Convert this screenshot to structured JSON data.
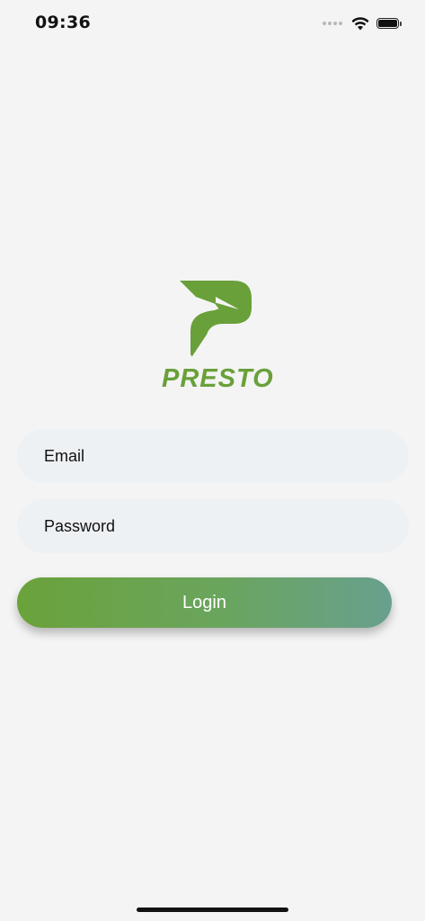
{
  "status_bar": {
    "time": "09:36"
  },
  "logo": {
    "text": "PRESTO",
    "icon": "presto-logo-icon",
    "color": "#69a03a"
  },
  "form": {
    "email_placeholder": "Email",
    "email_value": "",
    "password_placeholder": "Password",
    "password_value": "",
    "login_label": "Login"
  },
  "colors": {
    "background": "#f4f4f4",
    "field_background": "#eef1f4",
    "button_gradient_start": "#6aa23a",
    "button_gradient_end": "#68a08e"
  }
}
